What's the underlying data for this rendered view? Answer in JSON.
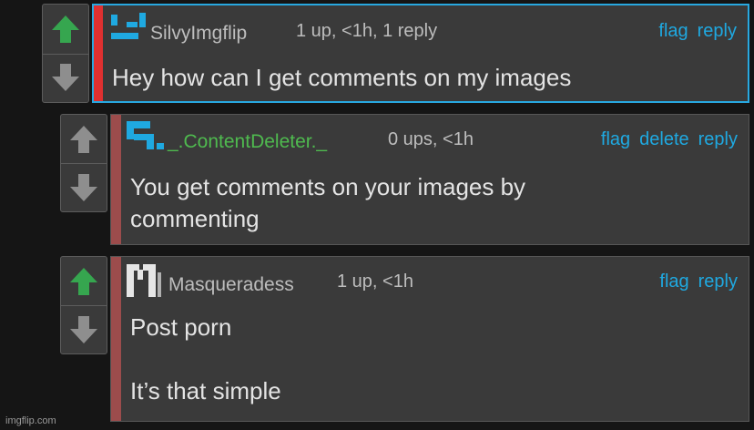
{
  "colors": {
    "upvote_active": "#36a64f",
    "vote_inactive": "#8e8e8e",
    "link": "#1fa9e1",
    "highlight_border": "#28a8e0",
    "op_bar": "#e03030",
    "reply_bar": "#9c4c4c",
    "username_default": "#bdbdbd",
    "username_special": "#4fba4f"
  },
  "comments": [
    {
      "username": "SilvyImgflip",
      "meta": "1 up, <1h, 1 reply",
      "actions": [
        "flag",
        "reply"
      ],
      "text": "Hey how can I get comments on my images",
      "upvoted": true,
      "avatar_icon": "pixel-avatar-icon"
    },
    {
      "username": "_.ContentDeleter._",
      "meta": "0 ups, <1h",
      "actions": [
        "flag",
        "delete",
        "reply"
      ],
      "text": "You get comments on your images by\ncommenting",
      "upvoted": false,
      "avatar_icon": "pixel-avatar-icon"
    },
    {
      "username": "Masqueradess",
      "meta": "1 up, <1h",
      "actions": [
        "flag",
        "reply"
      ],
      "text": "Post porn\n\nIt’s that simple",
      "upvoted": true,
      "avatar_icon": "pixel-avatar-icon"
    }
  ],
  "watermark": "imgflip.com"
}
